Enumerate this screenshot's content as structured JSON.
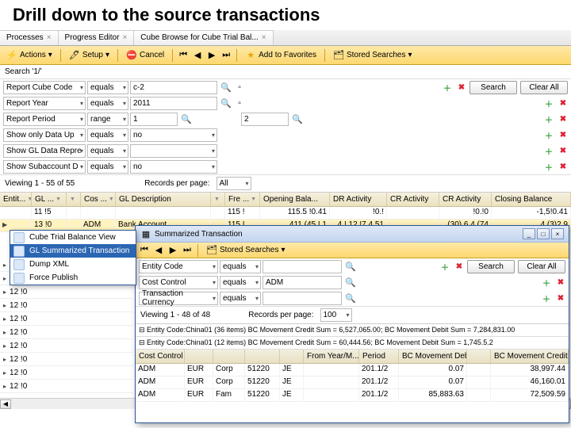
{
  "title": "Drill down to the source transactions",
  "tabs": [
    "Processes",
    "Progress Editor",
    "Cube Browse for Cube Trial Bal..."
  ],
  "toolbar": {
    "actions": "Actions",
    "setup": "Setup",
    "cancel": "Cancel",
    "addfav": "Add to Favorites",
    "stored": "Stored Searches"
  },
  "search_label": "Search '1/'",
  "filters": [
    {
      "field": "Report Cube Code",
      "op": "equals",
      "v1": "c-2",
      "icons": true,
      "showbtns": true
    },
    {
      "field": "Report Year",
      "op": "equals",
      "v1": "2011",
      "icons": true
    },
    {
      "field": "Report Period",
      "op": "range",
      "v1": "1",
      "v2": "2",
      "icons": true
    },
    {
      "field": "Show only Data Up",
      "op": "equals",
      "v1": "no",
      "icons": true
    },
    {
      "field": "Show GL Data Repre",
      "op": "equals",
      "v1": "",
      "icons": true
    },
    {
      "field": "Show Subaccount D",
      "op": "equals",
      "v1": "no",
      "icons": true
    }
  ],
  "btn_search": "Search",
  "btn_clear": "Clear All",
  "viewing": "Viewing 1 - 55 of 55",
  "rpp_label": "Records per page:",
  "rpp_value": "All",
  "cols": [
    "Entit...",
    "GL ...",
    "",
    "Cos ...",
    "GL Description",
    "",
    "Fre ...",
    "Opening Bala...",
    "DR Activity",
    "CR Activity",
    "CR Activity",
    "Closing Balance"
  ],
  "rows": [
    {
      "c": [
        "",
        "11 !5",
        "",
        "",
        "",
        "",
        "115 !",
        "",
        "115.5 !0.41",
        "!0.!",
        "",
        "!0.!0",
        "-1,5!0.41"
      ],
      "sel": false
    },
    {
      "c": [
        "",
        "13 !0",
        "",
        "ADM",
        "Bank Account",
        "",
        "115 !",
        "",
        "411.(45 !.1",
        "4 !.12 !7.4.51",
        "",
        "(30) 6 4 (74",
        "4,(3)2.9"
      ],
      "sel": true
    }
  ],
  "ctx": {
    "items": [
      "Cube Trial Balance View",
      "GL Summarized Transaction",
      "Dump XML",
      "Force Publish"
    ],
    "sel": 1
  },
  "left_rows": [
    "12 !0",
    "12 !0",
    "12 !0",
    "12 !0",
    "12 !0",
    "12 !0",
    "12 !0",
    "12 !0",
    "12 !0",
    "12 !0"
  ],
  "modal": {
    "title": "Summarized Transaction",
    "toolbar_stored": "Stored Searches",
    "filters": [
      {
        "field": "Entity Code",
        "op": "equals",
        "v1": ""
      },
      {
        "field": "Cost Control",
        "op": "equals",
        "v1": "ADM"
      },
      {
        "field": "Transaction Currency",
        "op": "equals",
        "v1": ""
      }
    ],
    "viewing": "Viewing 1 - 48 of 48",
    "rpp_label": "Records per page:",
    "rpp_value": "100",
    "summary1": "⊟ Entity Code:China01 (36 items) BC Movement Credit Sum = 6,527,065.00; BC Movement Debit Sum = 7,284,831.00",
    "summary2": "⊟ Entity Code:China01 (12 items) BC Movement Credit Sum = 60,444.56; BC Movement Debit Sum = 1,745.5.2",
    "cols": [
      "Cost Control",
      "",
      "",
      "",
      "",
      "From Year/M...",
      "Period",
      "BC Movement Debit",
      "",
      "BC Movement Credit"
    ],
    "rows": [
      {
        "c": [
          "ADM",
          "EUR",
          "Corp",
          "51220",
          "JE",
          "",
          "201.1/2",
          "",
          "0.07",
          "38,997.44"
        ]
      },
      {
        "c": [
          "ADM",
          "EUR",
          "Corp",
          "51220",
          "JE",
          "",
          "201.1/2",
          "",
          "0.07",
          "46,160.01"
        ]
      },
      {
        "c": [
          "ADM",
          "EUR",
          "Fam",
          "51220",
          "JE",
          "",
          "201.1/2",
          "",
          "85,883.63",
          "72,509.59"
        ]
      }
    ]
  }
}
